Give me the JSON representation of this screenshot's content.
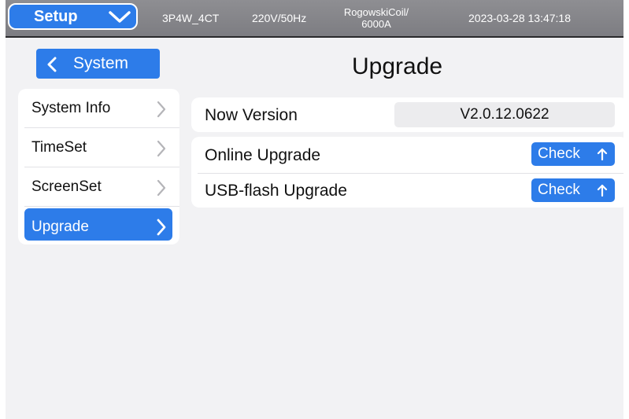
{
  "topbar": {
    "setup_label": "Setup",
    "wiring": "3P4W_4CT",
    "voltage_freq": "220V/50Hz",
    "sensor_line1": "RogowskiCoil/",
    "sensor_line2": "6000A",
    "datetime": "2023-03-28 13:47:18"
  },
  "nav": {
    "back_label": "System",
    "page_title": "Upgrade"
  },
  "menu": {
    "items": [
      {
        "label": "System Info"
      },
      {
        "label": "TimeSet"
      },
      {
        "label": "ScreenSet"
      },
      {
        "label": "Upgrade"
      }
    ]
  },
  "version": {
    "label": "Now Version",
    "value": "V2.0.12.0622"
  },
  "upgrade": {
    "online_label": "Online Upgrade",
    "usb_label": "USB-flash Upgrade",
    "check_label": "Check"
  },
  "colors": {
    "accent": "#2d7ce9",
    "statusbar": "#85858a",
    "background": "#f2f2f4"
  },
  "icons": [
    "chevron-down-icon",
    "chevron-left-icon",
    "chevron-right-icon",
    "arrow-up-icon"
  ]
}
